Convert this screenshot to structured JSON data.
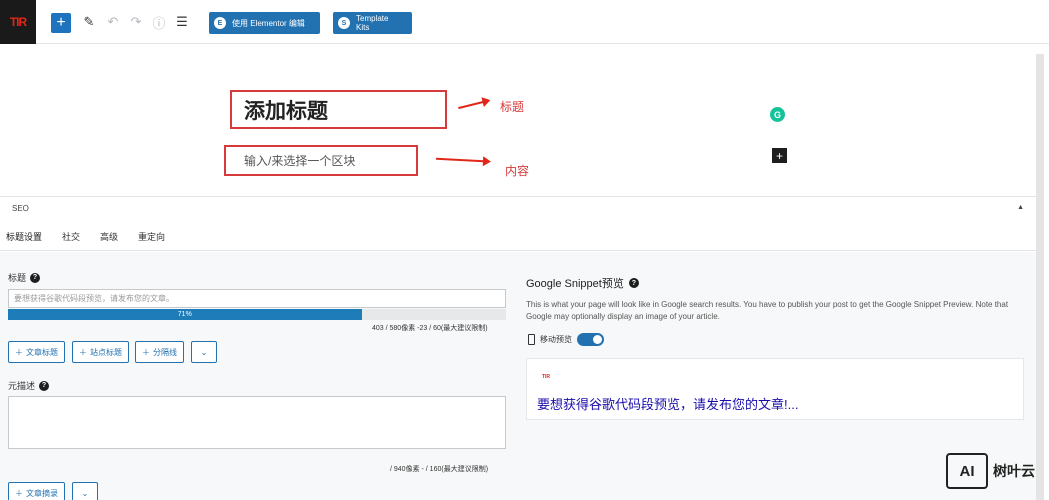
{
  "toolbar": {
    "logo_text": "TIR",
    "add_block": "+",
    "edit_icon": "pencil-icon",
    "undo_icon": "undo-icon",
    "redo_icon": "redo-icon",
    "info_icon": "info-icon",
    "list_view_icon": "list-view-icon",
    "elementor_label": "使用 Elementor 编辑",
    "template_kits_label": "Template Kits"
  },
  "editor": {
    "title_placeholder": "添加标题",
    "block_placeholder": "输入/来选择一个区块",
    "annotation_title": "标题",
    "annotation_content": "内容",
    "grammarly_icon": "grammarly-icon",
    "add_block_icon": "plus-icon"
  },
  "seo": {
    "panel_title": "SEO",
    "tabs": [
      "标题设置",
      "社交",
      "高级",
      "重定向"
    ],
    "title_label": "标题",
    "title_placeholder": "要想获得谷歌代码段预览，请发布您的文章。",
    "progress_percent": 71,
    "progress_label": "71%",
    "title_counter": "403 / 580像素 -23 / 60(最大建议限制)",
    "title_buttons": [
      "文章标题",
      "站点标题",
      "分隔线"
    ],
    "description_label": "元描述",
    "description_counter": "/ 940像素 - / 160(最大建议限制)",
    "description_buttons": [
      "文章摘录"
    ]
  },
  "snippet": {
    "title": "Google Snippet预览",
    "description": "This is what your page will look like in Google search results. You have to publish your post to get the Google Snippet Preview. Note that Google may optionally display an image of your article.",
    "mobile_label": "移动预览",
    "mobile_enabled": true,
    "favicon_text": "TIR",
    "preview_link": "要想获得谷歌代码段预览，请发布您的文章!..."
  },
  "watermark": {
    "badge": "AI",
    "text": "树叶云"
  },
  "colors": {
    "accent": "#2271b1",
    "annotation": "#d63a3a"
  }
}
